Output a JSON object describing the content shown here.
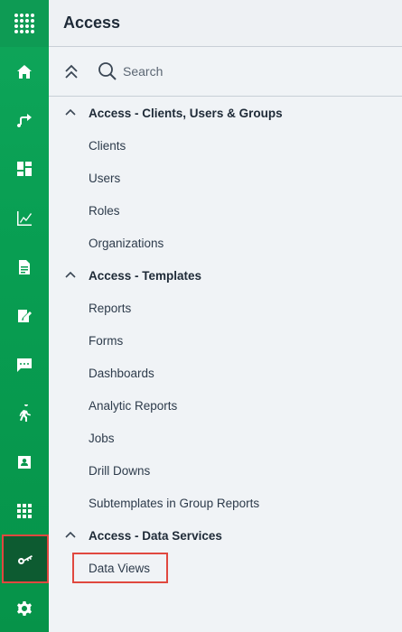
{
  "header": {
    "title": "Access"
  },
  "search": {
    "placeholder": "Search"
  },
  "rail": {
    "items": [
      {
        "icon": "home-icon"
      },
      {
        "icon": "workflow-icon"
      },
      {
        "icon": "dashboard-icon"
      },
      {
        "icon": "line-chart-icon"
      },
      {
        "icon": "document-icon"
      },
      {
        "icon": "form-edit-icon"
      },
      {
        "icon": "chat-icon"
      },
      {
        "icon": "runner-icon"
      },
      {
        "icon": "contact-card-icon"
      },
      {
        "icon": "apps-grid-icon"
      },
      {
        "icon": "key-icon",
        "active": true
      },
      {
        "icon": "gear-icon"
      }
    ]
  },
  "tree": {
    "groups": [
      {
        "label": "Access - Clients, Users & Groups",
        "items": [
          "Clients",
          "Users",
          "Roles",
          "Organizations"
        ]
      },
      {
        "label": "Access - Templates",
        "items": [
          "Reports",
          "Forms",
          "Dashboards",
          "Analytic Reports",
          "Jobs",
          "Drill Downs",
          "Subtemplates in Group Reports"
        ]
      },
      {
        "label": "Access - Data Services",
        "items": [
          "Data Views"
        ]
      }
    ]
  },
  "colors": {
    "rail_green": "#0fa65a",
    "rail_active": "#0d5b31",
    "highlight_red": "#e0483f",
    "panel_bg": "#f0f3f6"
  }
}
